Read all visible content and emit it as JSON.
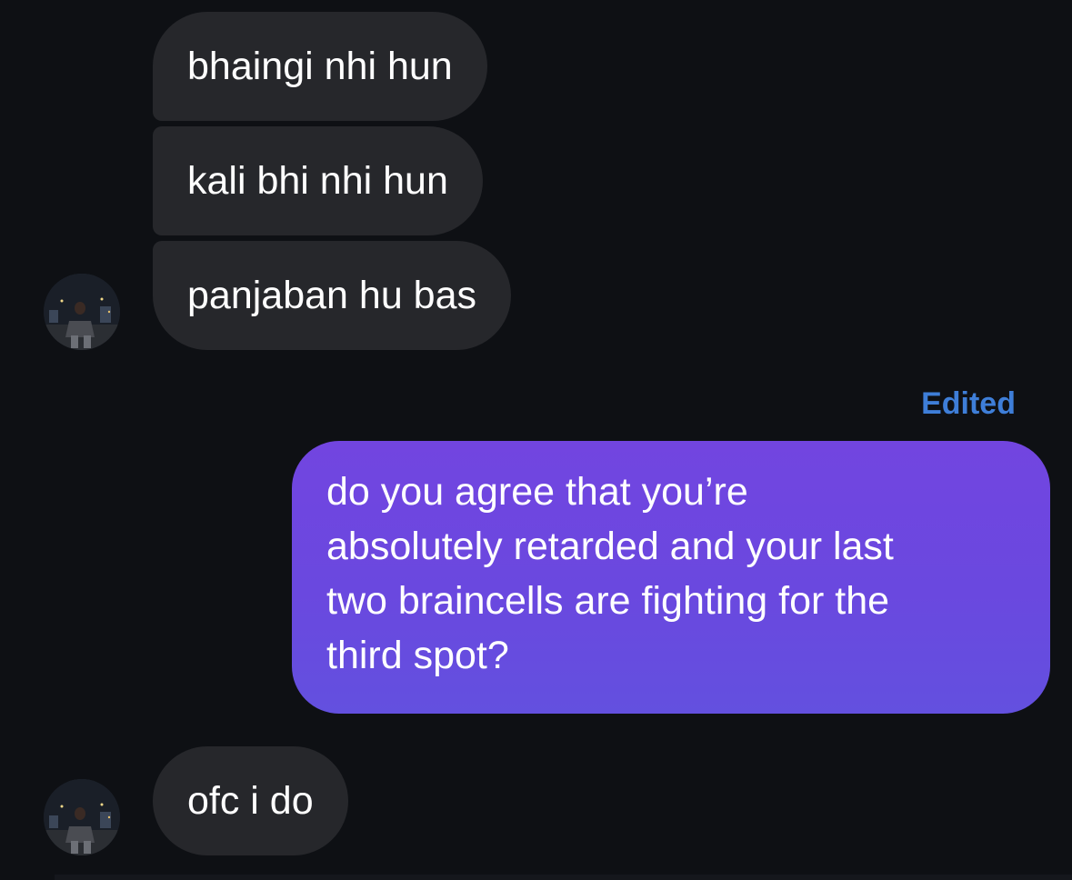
{
  "received_messages": [
    {
      "text": "bhaingi nhi hun"
    },
    {
      "text": "kali bhi nhi hun"
    },
    {
      "text": "panjaban hu bas"
    }
  ],
  "edited_label": "Edited",
  "sent_message": {
    "lines": [
      "do you agree that you’re",
      "absolutely retarded and your last",
      "two braincells are fighting for the",
      "third spot?"
    ]
  },
  "reply_message": {
    "text": "ofc i do"
  },
  "avatar_icon": "profile-photo-icon",
  "colors": {
    "background": "#0e1014",
    "received_bubble": "#26272b",
    "sent_bubble_top": "#7245e0",
    "sent_bubble_bottom": "#6350df",
    "edited_label": "#3e7ed8"
  }
}
